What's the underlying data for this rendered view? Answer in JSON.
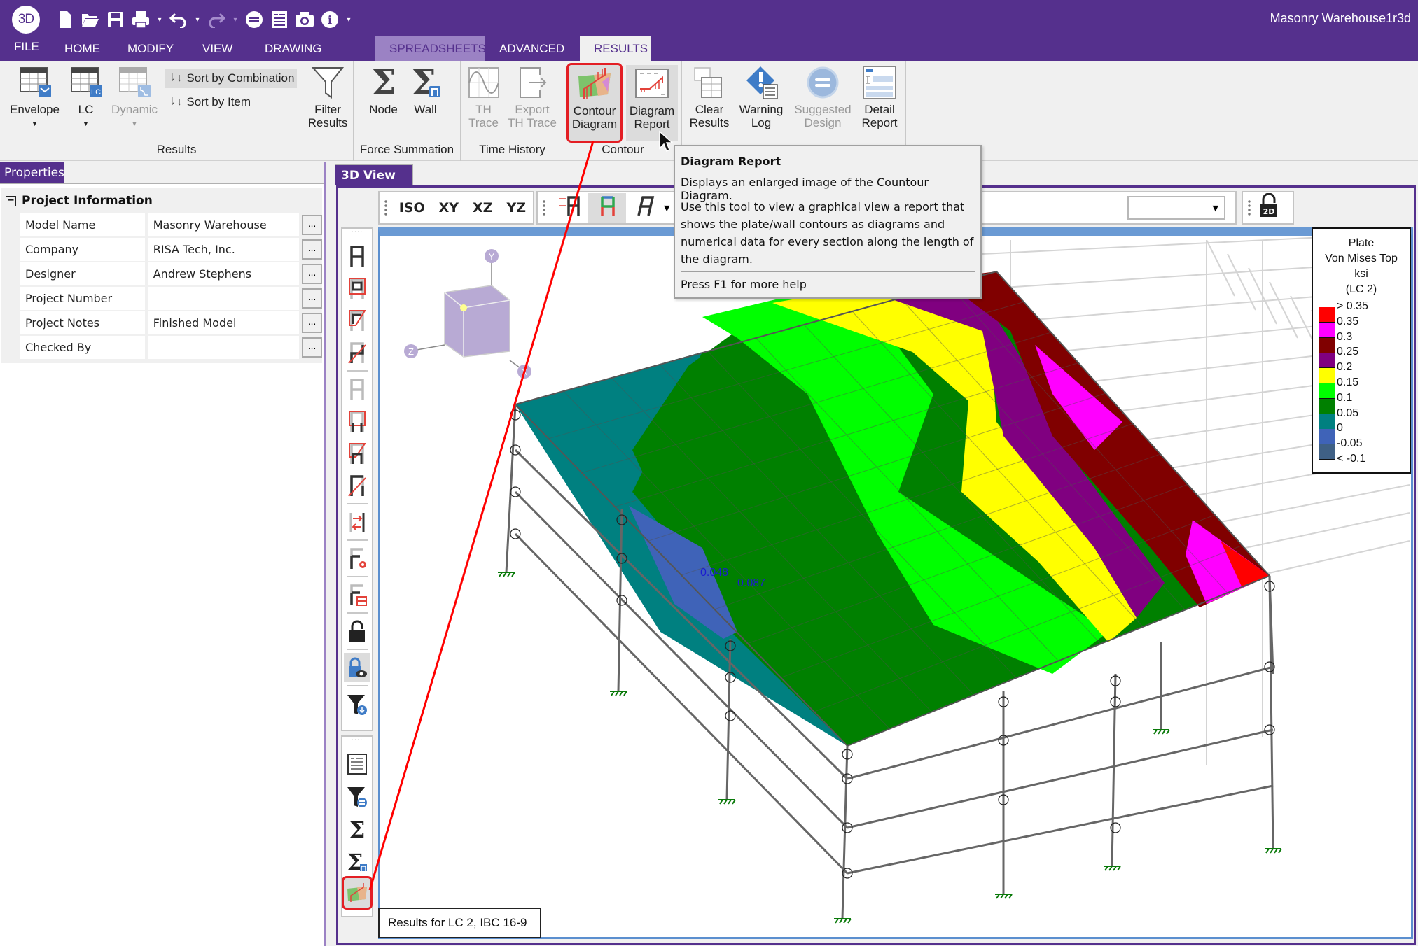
{
  "window": {
    "title": "Masonry Warehouse1r3d",
    "logo": "3D"
  },
  "quick_access": [
    {
      "icon": "new-file-icon",
      "glyph": "🗋"
    },
    {
      "icon": "open-folder-icon",
      "glyph": "📂"
    },
    {
      "icon": "save-icon",
      "glyph": "🖫"
    },
    {
      "icon": "print-icon",
      "glyph": "⎙"
    },
    {
      "icon": "undo-icon",
      "glyph": "↶"
    },
    {
      "icon": "redo-icon",
      "glyph": "↷"
    },
    {
      "icon": "solve-icon",
      "glyph": "⊜"
    },
    {
      "icon": "report-icon",
      "glyph": "☰"
    },
    {
      "icon": "camera-icon",
      "glyph": "📷"
    },
    {
      "icon": "info-icon",
      "glyph": "ℹ"
    }
  ],
  "menu_tabs": [
    {
      "label": "FILE"
    },
    {
      "label": "HOME"
    },
    {
      "label": "MODIFY"
    },
    {
      "label": "VIEW"
    },
    {
      "label": "DRAWING TOOLS"
    },
    {
      "label": "SPREADSHEETS"
    },
    {
      "label": "ADVANCED"
    },
    {
      "label": "RESULTS"
    }
  ],
  "active_tab": "RESULTS",
  "ribbon": {
    "results_group": {
      "label": "Results",
      "envelope": "Envelope",
      "lc": "LC",
      "dynamic": "Dynamic",
      "sort_by_combination": "Sort by Combination",
      "sort_by_item": "Sort by Item",
      "filter_results": [
        "Filter",
        "Results"
      ]
    },
    "force_summation_group": {
      "label": "Force Summation",
      "node": "Node",
      "wall": "Wall"
    },
    "time_history_group": {
      "label": "Time History",
      "th_trace": [
        "TH",
        "Trace"
      ],
      "export_th_trace": [
        "Export",
        "TH Trace"
      ]
    },
    "contour_group": {
      "label": "Contour",
      "contour_diagram": [
        "Contour",
        "Diagram"
      ],
      "diagram_report": [
        "Diagram",
        "Report"
      ]
    },
    "other": {
      "clear_results": [
        "Clear",
        "Results"
      ],
      "warning_log": [
        "Warning",
        "Log"
      ],
      "suggested_design": [
        "Suggested",
        "Design"
      ],
      "detail_report": [
        "Detail",
        "Report"
      ]
    }
  },
  "tooltip": {
    "title": "Diagram Report",
    "line1": "Displays an enlarged image of the Countour Diagram.",
    "line2": "Use this tool to view a graphical view a report that shows the plate/wall contours as diagrams and numerical data for every section along the length of the diagram.",
    "help": "Press F1 for more help"
  },
  "properties": {
    "tab_label": "Properties",
    "section": "Project Information",
    "rows": [
      {
        "key": "Model Name",
        "value": "Masonry Warehouse"
      },
      {
        "key": "Company",
        "value": "RISA Tech, Inc."
      },
      {
        "key": "Designer",
        "value": "Andrew Stephens"
      },
      {
        "key": "Project Number",
        "value": ""
      },
      {
        "key": "Project Notes",
        "value": "Finished Model"
      },
      {
        "key": "Checked By",
        "value": ""
      }
    ],
    "ellipsis": "..."
  },
  "view": {
    "tab_label": "3D View",
    "close": "✕",
    "view_buttons": [
      "ISO",
      "XY",
      "XZ",
      "YZ"
    ],
    "dropdown_value": "",
    "lock_2d_label": "2D",
    "axes": {
      "x": "X",
      "y": "Y",
      "z": "Z"
    },
    "annotations": [
      "0.048",
      "0.087"
    ],
    "status_tip": "Results for LC 2, IBC 16-9"
  },
  "legend": {
    "title_lines": [
      "Plate",
      "Von Mises Top",
      "ksi",
      "(LC 2)"
    ],
    "entries": [
      {
        "label": "> 0.35",
        "color": "#ff0000"
      },
      {
        "label": "0.35",
        "color": "#ff00ff"
      },
      {
        "label": "0.3",
        "color": "#800000"
      },
      {
        "label": "0.25",
        "color": "#800080"
      },
      {
        "label": "0.2",
        "color": "#ffff00"
      },
      {
        "label": "0.15",
        "color": "#00ff00"
      },
      {
        "label": "0.1",
        "color": "#008000"
      },
      {
        "label": "0.05",
        "color": "#008080"
      },
      {
        "label": "0",
        "color": "#3f63b8"
      },
      {
        "label": "-0.05",
        "color": "#3f6085"
      },
      {
        "label": "< -0.1",
        "color": ""
      }
    ]
  },
  "colors": {
    "brand": "#55308d",
    "brand_light": "#9b82c4",
    "highlight_box": "#e31e24"
  }
}
